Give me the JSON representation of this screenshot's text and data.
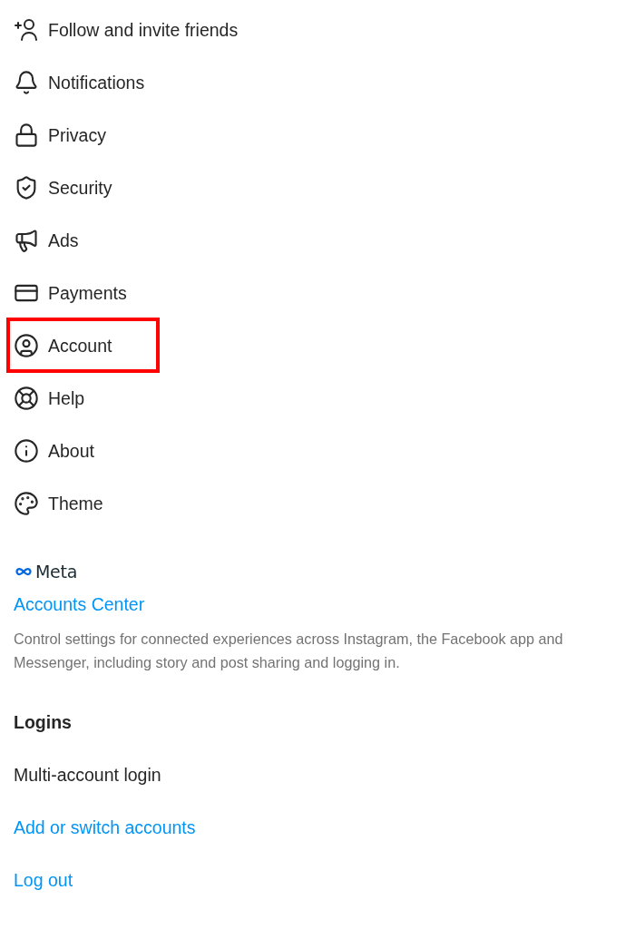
{
  "menu": {
    "items": [
      {
        "label": "Follow and invite friends",
        "highlighted": false
      },
      {
        "label": "Notifications",
        "highlighted": false
      },
      {
        "label": "Privacy",
        "highlighted": false
      },
      {
        "label": "Security",
        "highlighted": false
      },
      {
        "label": "Ads",
        "highlighted": false
      },
      {
        "label": "Payments",
        "highlighted": false
      },
      {
        "label": "Account",
        "highlighted": true
      },
      {
        "label": "Help",
        "highlighted": false
      },
      {
        "label": "About",
        "highlighted": false
      },
      {
        "label": "Theme",
        "highlighted": false
      }
    ]
  },
  "meta": {
    "wordmark": "Meta",
    "link": "Accounts Center",
    "description": "Control settings for connected experiences across Instagram, the Facebook app and Messenger, including story and post sharing and logging in."
  },
  "logins": {
    "title": "Logins",
    "items": [
      {
        "label": "Multi-account login",
        "kind": "option"
      },
      {
        "label": "Add or switch accounts",
        "kind": "link"
      },
      {
        "label": "Log out",
        "kind": "link"
      }
    ]
  }
}
